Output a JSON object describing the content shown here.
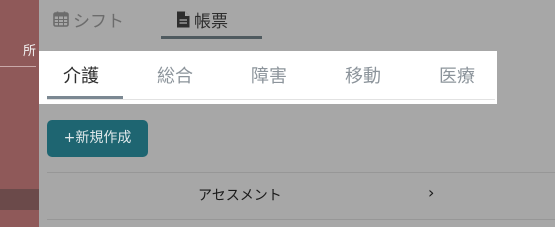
{
  "sidebar": {
    "partial_text": "所"
  },
  "top_tabs": [
    {
      "label": "シフト",
      "icon": "calendar-icon"
    },
    {
      "label": "帳票",
      "icon": "document-icon"
    }
  ],
  "sub_tabs": [
    {
      "label": "介護"
    },
    {
      "label": "総合"
    },
    {
      "label": "障害"
    },
    {
      "label": "移動"
    },
    {
      "label": "医療"
    }
  ],
  "new_button_label": "+新規作成",
  "list": [
    {
      "label": "アセスメント",
      "chevron": "›"
    }
  ],
  "colors": {
    "overlay": "#a7a7a7",
    "sidebar": "#8f5959",
    "button": "#1e6571"
  }
}
